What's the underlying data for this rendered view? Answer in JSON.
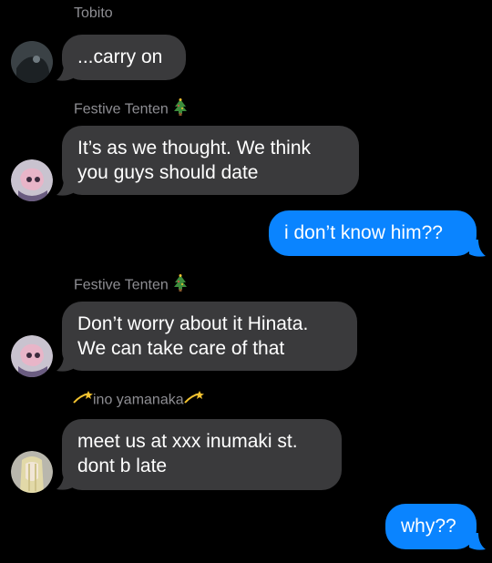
{
  "conversation": {
    "messages": [
      {
        "sender": "Tobito",
        "text": "...carry on"
      },
      {
        "sender": "Festive Tenten",
        "sender_icon": "christmas-tree-icon",
        "text_lines": [
          "It’s as we thought. We think",
          "you guys should date"
        ]
      },
      {
        "outgoing": true,
        "text": "i don’t know him??"
      },
      {
        "sender": "Festive Tenten",
        "sender_icon": "christmas-tree-icon",
        "text_lines": [
          "Don’t worry about it Hinata.",
          "We can take care of that"
        ]
      },
      {
        "sender": "ino yamanaka",
        "sender_icon": "dizzy-star-icon",
        "text_lines": [
          "meet us at xxx inumaki st.",
          "dont b late"
        ]
      },
      {
        "outgoing": true,
        "text": "why??"
      }
    ]
  },
  "colors": {
    "background": "#000000",
    "incoming_bubble": "#3a3a3c",
    "outgoing_bubble": "#0a84ff",
    "sender_name": "#8e8e93"
  }
}
